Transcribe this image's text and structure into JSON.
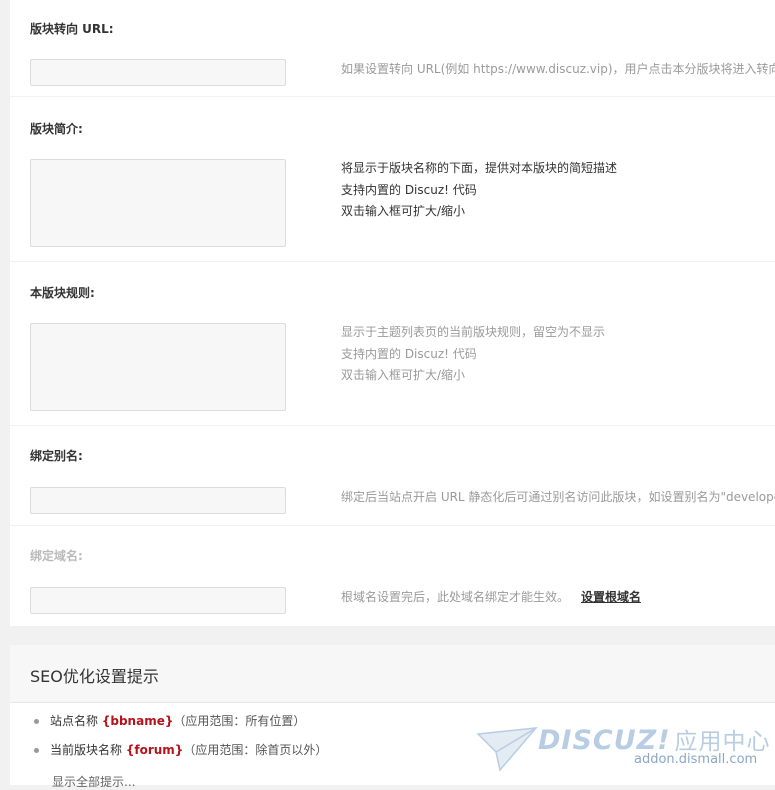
{
  "form": {
    "redirect_url": {
      "label": "版块转向 URL:",
      "value": "",
      "tip": "如果设置转向 URL(例如 https://www.discuz.vip)，用户点击本分版块将进入转向中"
    },
    "description": {
      "label": "版块简介:",
      "value": "",
      "tips": [
        "将显示于版块名称的下面，提供对本版块的简短描述",
        "支持内置的 Discuz! 代码",
        "双击输入框可扩大/缩小"
      ]
    },
    "rules": {
      "label": "本版块规则:",
      "value": "",
      "tips": [
        "显示于主题列表页的当前版块规则，留空为不显示",
        "支持内置的 Discuz! 代码",
        "双击输入框可扩大/缩小"
      ]
    },
    "alias": {
      "label": "绑定别名:",
      "value": "",
      "tip": "绑定后当站点开启 URL 静态化后可通过别名访问此版块，如设置别名为\"develope"
    },
    "domain": {
      "label": "绑定域名:",
      "value": "",
      "tip": "根域名设置完后，此处域名绑定才能生效。",
      "link": "设置根域名"
    }
  },
  "seo": {
    "title": "SEO优化设置提示",
    "items": [
      {
        "prefix": "站点名称 ",
        "var": "{bbname}",
        "suffix": "（应用范围：所有位置）"
      },
      {
        "prefix": "当前版块名称 ",
        "var": "{forum}",
        "suffix": "（应用范围：除首页以外）"
      }
    ],
    "more": "显示全部提示..."
  },
  "watermark": {
    "brand": "DISCUZ!",
    "brand_cn": "应用中心",
    "url": "addon.dismall.com"
  }
}
